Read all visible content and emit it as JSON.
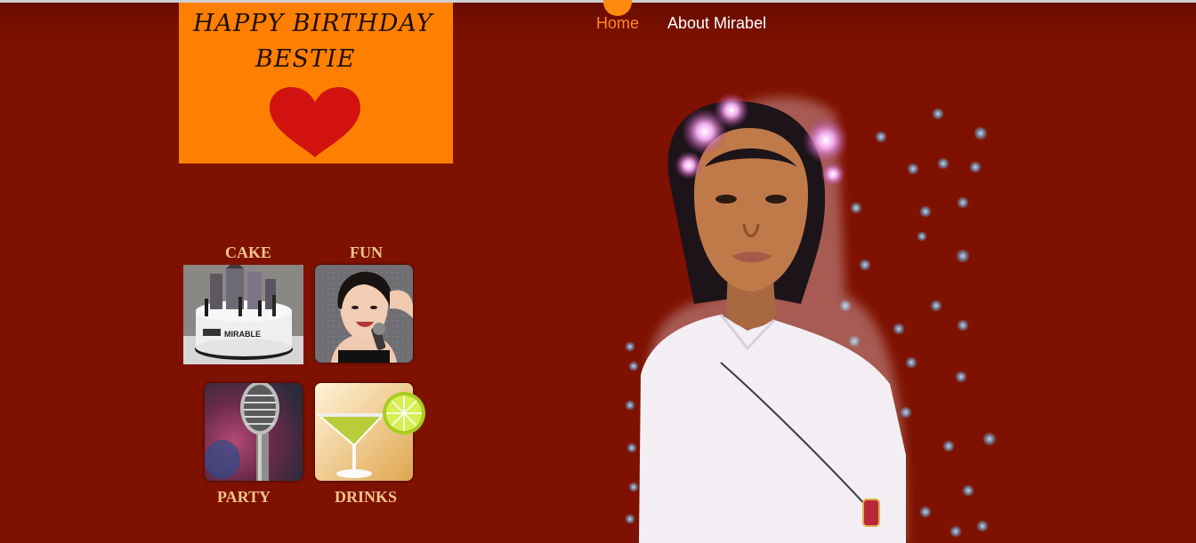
{
  "nav": {
    "items": [
      {
        "label": "Home",
        "active": true
      },
      {
        "label": "About Mirabel",
        "active": false
      }
    ]
  },
  "banner": {
    "line1": "HAPPY BIRTHDAY",
    "line2": "BESTIE",
    "icon": "heart-icon",
    "bg_color": "#ff8000",
    "heart_color": "#d2120f"
  },
  "gallery": {
    "items": [
      {
        "caption": "CAKE",
        "image": "cake-image",
        "cake_text": "MIRABLE"
      },
      {
        "caption": "FUN",
        "image": "singer-girl-image"
      },
      {
        "caption": "PARTY",
        "image": "microphone-image"
      },
      {
        "caption": "DRINKS",
        "image": "cocktail-image"
      }
    ]
  },
  "colors": {
    "page_bg": "#7e1100",
    "accent": "#ff8a1e",
    "caption": "#f2c488"
  }
}
